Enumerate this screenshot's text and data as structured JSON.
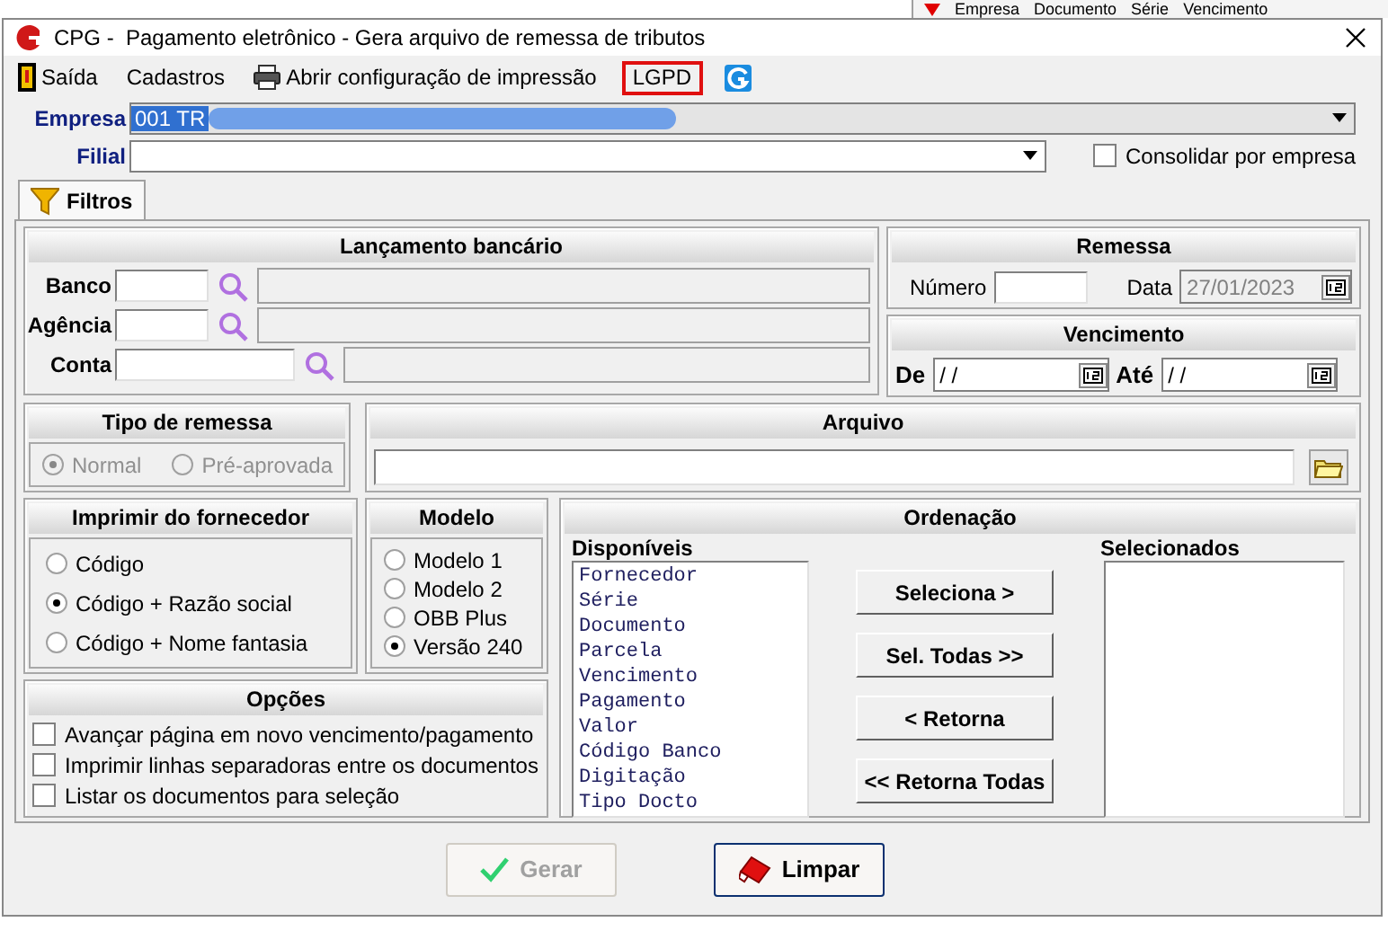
{
  "background_window": {
    "columns": [
      "Empresa",
      "Documento",
      "Série",
      "Vencimento"
    ]
  },
  "window": {
    "title": "CPG -  Pagamento eletrônico - Gera arquivo de remessa de tributos"
  },
  "toolbar": [
    {
      "kind": "exit",
      "label": "Saída"
    },
    {
      "kind": "plain",
      "label": "Cadastros"
    },
    {
      "kind": "print",
      "label": "Abrir configuração de impressão"
    },
    {
      "kind": "highlighted",
      "label": "LGPD"
    },
    {
      "kind": "logo"
    }
  ],
  "empresa": {
    "label": "Empresa",
    "value": "001 TR"
  },
  "filial": {
    "label": "Filial"
  },
  "consolidar": {
    "label": "Consolidar por empresa",
    "checked": false
  },
  "tabs": [
    {
      "label": "Filtros",
      "selected": true
    }
  ],
  "lancamento": {
    "title": "Lançamento bancário",
    "fields": [
      {
        "label": "Banco",
        "kind": "short"
      },
      {
        "label": "Agência",
        "kind": "short"
      },
      {
        "label": "Conta",
        "kind": "long"
      }
    ]
  },
  "remessa": {
    "title": "Remessa",
    "numero_label": "Número",
    "data_label": "Data",
    "data_value": "27/01/2023",
    "data_disabled": true
  },
  "vencimento": {
    "title": "Vencimento",
    "de_label": "De",
    "de_value": "/ /",
    "ate_label": "Até",
    "ate_value": "/ /"
  },
  "tipo_remessa": {
    "title": "Tipo de remessa",
    "disabled": true,
    "options": [
      {
        "label": "Normal",
        "selected": true
      },
      {
        "label": "Pré-aprovada",
        "selected": false
      }
    ]
  },
  "arquivo": {
    "title": "Arquivo"
  },
  "imprimir_fornecedor": {
    "title": "Imprimir do fornecedor",
    "options": [
      {
        "label": "Código",
        "selected": false
      },
      {
        "label": "Código + Razão social",
        "selected": true
      },
      {
        "label": "Código + Nome fantasia",
        "selected": false
      }
    ]
  },
  "modelo": {
    "title": "Modelo",
    "options": [
      {
        "label": "Modelo 1",
        "selected": false
      },
      {
        "label": "Modelo 2",
        "selected": false
      },
      {
        "label": "OBB Plus",
        "selected": false
      },
      {
        "label": "Versão 240",
        "selected": true
      }
    ]
  },
  "opcoes": {
    "title": "Opções",
    "items": [
      {
        "label": "Avançar página em novo vencimento/pagamento",
        "checked": false
      },
      {
        "label": "Imprimir linhas separadoras entre os documentos",
        "checked": false
      },
      {
        "label": "Listar os documentos para seleção",
        "checked": false
      }
    ]
  },
  "ordenacao": {
    "title": "Ordenação",
    "available_label": "Disponíveis",
    "available": [
      "Fornecedor",
      "Série",
      "Documento",
      "Parcela",
      "Vencimento",
      "Pagamento",
      "Valor",
      "Código Banco",
      "Digitação",
      "Tipo Docto"
    ],
    "selected_label": "Selecionados",
    "buttons": [
      "Seleciona >",
      "Sel. Todas >>",
      "< Retorna",
      "<< Retorna Todas"
    ]
  },
  "actions": [
    {
      "kind": "generate",
      "label": "Gerar",
      "disabled": true
    },
    {
      "kind": "clear",
      "label": "Limpar",
      "disabled": false
    }
  ]
}
